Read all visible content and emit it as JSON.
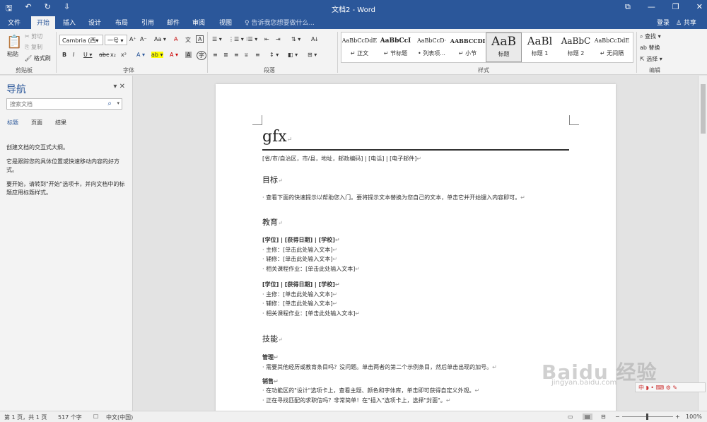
{
  "window": {
    "title": "文档2 - Word",
    "qat": [
      "🖫",
      "↶",
      "↻",
      "⇩"
    ],
    "controls": [
      "⧉",
      "—",
      "❐",
      "✕"
    ]
  },
  "tabs": [
    "文件",
    "开始",
    "插入",
    "设计",
    "布局",
    "引用",
    "邮件",
    "审阅",
    "视图"
  ],
  "active_tab": "开始",
  "tellme": "♀ 告诉我您想要做什么...",
  "account": {
    "login": "登录",
    "share": "♙ 共享"
  },
  "ribbon": {
    "clipboard": {
      "paste": "粘贴",
      "cut": "✂ 剪切",
      "copy": "⎘ 复制",
      "format_painter": "🖌 格式刷",
      "label": "剪贴板"
    },
    "font": {
      "font_name": "Cambria (西▾",
      "font_size": "一号  ▾",
      "grow": "A⁺",
      "shrink": "A⁻",
      "case": "Aa ▾",
      "clear": "A̶",
      "pinyin": "文",
      "border": "A",
      "bold": "B",
      "italic": "I",
      "underline": "U ▾",
      "strike": "abc",
      "sub": "x₂",
      "sup": "x²",
      "effects": "A ▾",
      "highlight": "ab ▾",
      "color": "A ▾",
      "shade": "A",
      "circle": "字",
      "label": "字体"
    },
    "paragraph": {
      "row1": [
        "☰ ▾",
        "⋮☰ ▾",
        "⁝☰ ▾",
        "⇤",
        "⇥",
        "⇅ ▾",
        "Aↆ"
      ],
      "row2": [
        "≡",
        "≣",
        "≡",
        "⩸",
        "≡",
        "↕ ▾",
        "◧ ▾",
        "⊞ ▾"
      ],
      "label": "段落"
    },
    "styles": {
      "items": [
        {
          "preview": "AaBbCcDdE",
          "name": "↵ 正文"
        },
        {
          "preview": "AaBbCcI",
          "name": "↵ 节标题"
        },
        {
          "preview": "AaBbCcD·",
          "name": "• 列表项..."
        },
        {
          "preview": "AABBCCDI",
          "name": "↵ 小节"
        },
        {
          "preview": "AaB",
          "name": "标题"
        },
        {
          "preview": "AaBl",
          "name": "标题 1"
        },
        {
          "preview": "AaBbC",
          "name": "标题 2"
        },
        {
          "preview": "AaBbCcDdE",
          "name": "↵ 无间隔"
        }
      ],
      "label": "样式"
    },
    "editing": {
      "find": "⌕ 查找 ▾",
      "replace": "ab 替换",
      "select": "⇱ 选择 ▾",
      "label": "编辑"
    }
  },
  "nav": {
    "title": "导航",
    "controls": "▾ ✕",
    "search_placeholder": "搜索文档",
    "search_icon": "⌕",
    "tabs": [
      "标题",
      "页面",
      "结果"
    ],
    "active_tab": "标题",
    "help": [
      "创建文档的交互式大纲。",
      "它是跟踪您的具体位置或快速移动内容的好方式。",
      "要开始，请转到\"开始\"选项卡，并向文档中的标题应用标题样式。"
    ]
  },
  "document": {
    "name": "gfx",
    "contact": "[省/市/自治区，市/县，地址，邮政编码] | [电话] | [电子邮件]",
    "sections": [
      {
        "heading": "目标",
        "lines": [
          {
            "text": "· 查看下面的快速提示以帮助您入门。要将提示文本替换为您自己的文本，单击它并开始键入内容即可。",
            "bold": false
          }
        ]
      },
      {
        "heading": "教育",
        "lines": [
          {
            "text": "[学位] | [获得日期] | [学校]",
            "bold": true
          },
          {
            "text": "· 主修：[单击此处输入文本]",
            "bold": false
          },
          {
            "text": "· 辅修：[单击此处输入文本]",
            "bold": false
          },
          {
            "text": "· 相关课程作业：[单击此处输入文本]",
            "bold": false
          },
          {
            "text": "[学位] | [获得日期] | [学校]",
            "bold": true
          },
          {
            "text": "· 主修：[单击此处输入文本]",
            "bold": false
          },
          {
            "text": "· 辅修：[单击此处输入文本]",
            "bold": false
          },
          {
            "text": "· 相关课程作业：[单击此处输入文本]",
            "bold": false
          }
        ]
      },
      {
        "heading": "技能",
        "lines": [
          {
            "text": "管理",
            "bold": true
          },
          {
            "text": "· 需要其他经历或教育条目吗？没问题。单击两者的第二个示例条目，然后单击出现的加号。",
            "bold": false
          },
          {
            "text": "销售",
            "bold": true
          },
          {
            "text": "· 在功能区的\"设计\"选项卡上，查看主题、颜色和字体库，单击即可获得自定义外观。",
            "bold": false
          },
          {
            "text": "· 正在寻找匹配的求职信吗？非常简单！在\"插入\"选项卡上，选择\"封面\"。",
            "bold": false
          }
        ]
      }
    ]
  },
  "status": {
    "page": "第 1 页，共 1 页",
    "words": "517 个字",
    "proof": "☐",
    "language": "中文(中国)",
    "zoom": "100%",
    "zoom_minus": "−",
    "zoom_plus": "+"
  },
  "watermark": {
    "brand": "Baidu 经验",
    "url": "jingyan.baidu.com"
  },
  "ime": {
    "text": "中 ◗ • ⌨ ⚙ ✎"
  },
  "colors": {
    "accent": "#2b579a",
    "ribbon": "#f3f3f3",
    "canvas": "#e3e3e3"
  }
}
